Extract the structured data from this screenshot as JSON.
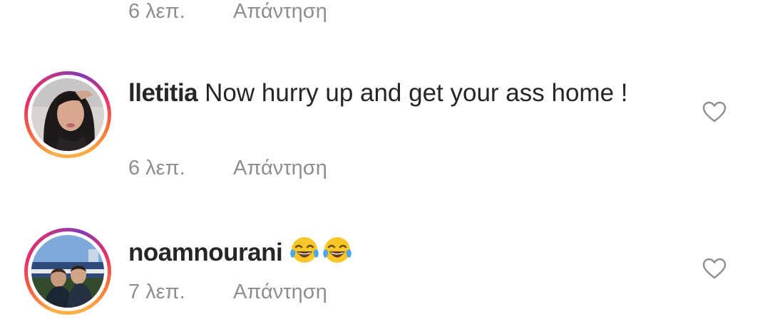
{
  "top_meta": {
    "time": "6 λεπ.",
    "reply": "Απάντηση"
  },
  "comments": [
    {
      "username": "lletitia",
      "text": "Now hurry up and get your ass home !",
      "time": "6 λεπ.",
      "reply": "Απάντηση",
      "avatar": "user-photo-woman",
      "like_icon": "heart-outline-icon"
    },
    {
      "username": "noamnourani",
      "emojis": [
        "face-with-tears-of-joy",
        "face-with-tears-of-joy"
      ],
      "time": "7 λεπ.",
      "reply": "Απάντηση",
      "avatar": "user-photo-stadium",
      "like_icon": "heart-outline-icon"
    }
  ],
  "colors": {
    "text": "#262626",
    "meta": "#8e8e8e",
    "ring": [
      "#fcaf45",
      "#f56040",
      "#e1306c",
      "#c13584",
      "#833ab4"
    ]
  }
}
